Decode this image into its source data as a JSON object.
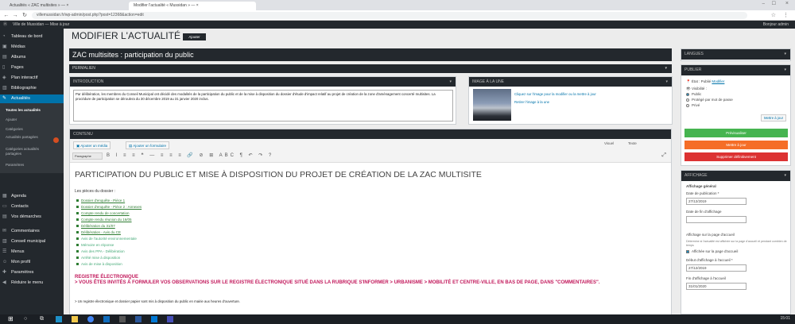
{
  "browser": {
    "tabs": [
      "Actualités « ZAC multisites » — ×",
      "Modifier l'actualité « Mussidan » — ×"
    ],
    "url": "villemussidan.fr/wp-admin/post.php?post=12368&action=edit",
    "nav_icons": [
      "back-icon",
      "forward-icon",
      "reload-icon",
      "home-icon"
    ]
  },
  "adminbar": {
    "site": "Ville de Mussidan — Mise à jour",
    "user": "Bonjour admin"
  },
  "sidebar": {
    "items": [
      {
        "label": "Tableau de bord",
        "icon": "dashboard-icon"
      },
      {
        "label": "Médias",
        "icon": "media-icon"
      },
      {
        "label": "Albums",
        "icon": "album-icon"
      },
      {
        "label": "Pages",
        "icon": "page-icon"
      },
      {
        "label": "Plan interactif",
        "icon": "map-icon"
      },
      {
        "label": "Bibliographie",
        "icon": "book-icon"
      },
      {
        "label": "Actualités",
        "icon": "pin-icon"
      },
      {
        "label": "Agenda",
        "icon": "calendar-icon"
      },
      {
        "label": "Contacts",
        "icon": "contact-icon"
      },
      {
        "label": "Vos démarches",
        "icon": "form-icon"
      },
      {
        "label": "Commentaires",
        "icon": "comment-icon"
      },
      {
        "label": "Conseil municipal",
        "icon": "building-icon"
      },
      {
        "label": "Menus",
        "icon": "menu-icon"
      },
      {
        "label": "Mon profil",
        "icon": "user-icon"
      },
      {
        "label": "Paramètres",
        "icon": "settings-icon"
      },
      {
        "label": "Réduire le menu",
        "icon": "collapse-icon"
      }
    ],
    "submenu": [
      "Toutes les actualités",
      "Ajouter",
      "Catégories",
      "Actualités partagées",
      "Catégories actualités partagées",
      "Paramètres"
    ]
  },
  "page": {
    "title": "MODIFIER L'ACTUALITÉ",
    "add_new": "Ajouter"
  },
  "post": {
    "title": "ZAC multisites : participation du public"
  },
  "permalink_label": "PERMALIEN",
  "intro": {
    "heading": "INTRODUCTION",
    "text": "Par délibération, les membres du Conseil Municipal ont décidé des modalités de la participation du public et de la mise à disposition du dossier d'étude d'impact relatif au projet de création de la zone d'aménagement concerté multisites. La procédure de participation se déroulera du 30 décembre 2019 au 31 janvier 2020 inclus."
  },
  "featured": {
    "heading": "IMAGE À LA UNE",
    "caption": "Cliquez sur l'image pour la modifier ou la mettre à jour",
    "remove": "Retirer l'image à la une"
  },
  "editor": {
    "heading": "CONTENU",
    "add_media": "Ajouter un média",
    "add_form": "Ajouter un formulaire",
    "tab_visual": "Visuel",
    "tab_text": "Texte",
    "paragraph": "Paragraphe",
    "format_toolbar": "B I ≡ ≡ ❝ — ≡ ≡ ≡ 🔗 ⊘ ⊞ ABC ¶ ↶ ↷ ?",
    "body_heading": "PARTICIPATION DU PUBLIC ET MISE À DISPOSITION DU PROJET DE CRÉATION DE LA ZAC MULTISITE",
    "docs_label": "Les pièces du dossier :",
    "documents": [
      "Dossier d'enquête - Pièce 1",
      "Dossier d'enquête - Pièce 2 : Annexes",
      "Compte rendu de concertation",
      "Compte rendu réunion du 16/05",
      "Délibération du 31/07",
      "Délibération - Avis du CE",
      "Avis de l'autorité environnementale",
      "Mémoire en réponse",
      "Avis des PPA - Délibération",
      "Arrêté mise à disposition",
      "Avis de mise à disposition"
    ],
    "register_title": "REGISTRE ÉLECTRONIQUE",
    "register_note": "> VOUS ÊTES INVITÉS À FORMULER VOS OBSERVATIONS SUR LE REGISTRE ÉLECTRONIQUE SITUÉ DANS LA RUBRIQUE S'INFORMER > URBANISME > MOBILITÉ ET CENTRE-VILLE, EN BAS DE PAGE, DANS \"COMMENTAIRES\".",
    "register_foot": "> Un registre électronique et dossier papier sont mis à disposition du public en mairie aux heures d'ouverture."
  },
  "right": {
    "lang_heading": "LANGUES",
    "publish_heading": "PUBLIER",
    "status_label": "État : Publié",
    "status_link": "Modifier",
    "visibility_label": "Visibilité :",
    "visibility_options": [
      "Public",
      "Protégé par mot de passe",
      "Privé"
    ],
    "ok_button": "Mettre à jour",
    "btn_preview": "Prévisualiser",
    "btn_update": "Mettre à jour",
    "btn_trash": "Supprimer définitivement",
    "display_heading": "AFFICHAGE",
    "display_general": "Affichage général",
    "pubdate_label": "Date de publication *",
    "pubdate_value": "27/12/2019",
    "enddate_label": "Date de fin d'affichage",
    "home_label": "Affichage sur la page d'accueil",
    "home_note": "Détermine si l'actualité est affichée sur la page d'accueil et pendant combien de temps",
    "home_checkbox": "Affichée sur la page d'accueil",
    "home_start_label": "Début d'affichage à l'accueil *",
    "home_start_value": "27/12/2019",
    "home_end_label": "Fin d'affichage à l'accueil",
    "home_end_value": "31/01/2020"
  },
  "taskbar": {
    "icons": [
      "windows-icon",
      "search-icon",
      "taskview-icon",
      "edge-icon",
      "explorer-icon",
      "chrome-icon",
      "mail-icon",
      "store-icon",
      "word-icon",
      "photos-icon",
      "teams-icon"
    ],
    "clock": "15:01"
  },
  "colors": {
    "wp_dark": "#23282d",
    "wp_blue": "#0073aa",
    "green": "#46b450",
    "orange": "#f56e28",
    "red": "#dc3232"
  }
}
